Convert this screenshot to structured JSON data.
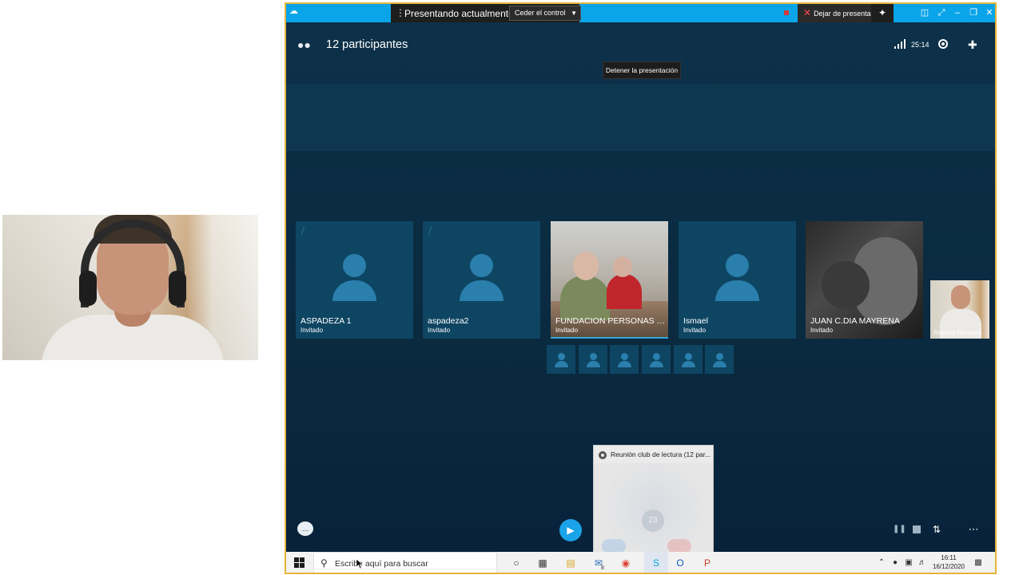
{
  "left_video": {
    "description": ""
  },
  "window": {
    "presenting_label": "Presentando actualmente",
    "cede_control_label": "Ceder el control",
    "stop_presenting_label": "Dejar de presentar",
    "participants_label": "12 participantes",
    "call_timer": "25:14",
    "tooltip": "Detener la presentación"
  },
  "participants": [
    {
      "name": "ASPADEZA 1",
      "role": "Invitado",
      "muted": true,
      "video": false
    },
    {
      "name": "aspadeza2",
      "role": "Invitado",
      "muted": true,
      "video": false
    },
    {
      "name": "FUNDACION PERSONAS CA...",
      "role": "Invitado",
      "muted": false,
      "video": true
    },
    {
      "name": "Ismael",
      "role": "Invitado",
      "muted": false,
      "video": false
    },
    {
      "name": "JUAN C.DIA MAYRENA",
      "role": "Invitado",
      "muted": false,
      "video": true
    }
  ],
  "self_view": {
    "name": "Antonio Hinojosa"
  },
  "preview": {
    "title": "Reunión club de lectura (12 par...",
    "calendar_day": "23"
  },
  "taskbar": {
    "search_placeholder": "Escribe aquí para buscar",
    "mail_badge": "8",
    "time": "16:11",
    "date": "16/12/2020"
  },
  "colors": {
    "titlebar": "#0aa4e8",
    "window_bg": "#0c3049",
    "tile_bg": "#0e4562",
    "accent_border": "#e6b43c"
  }
}
